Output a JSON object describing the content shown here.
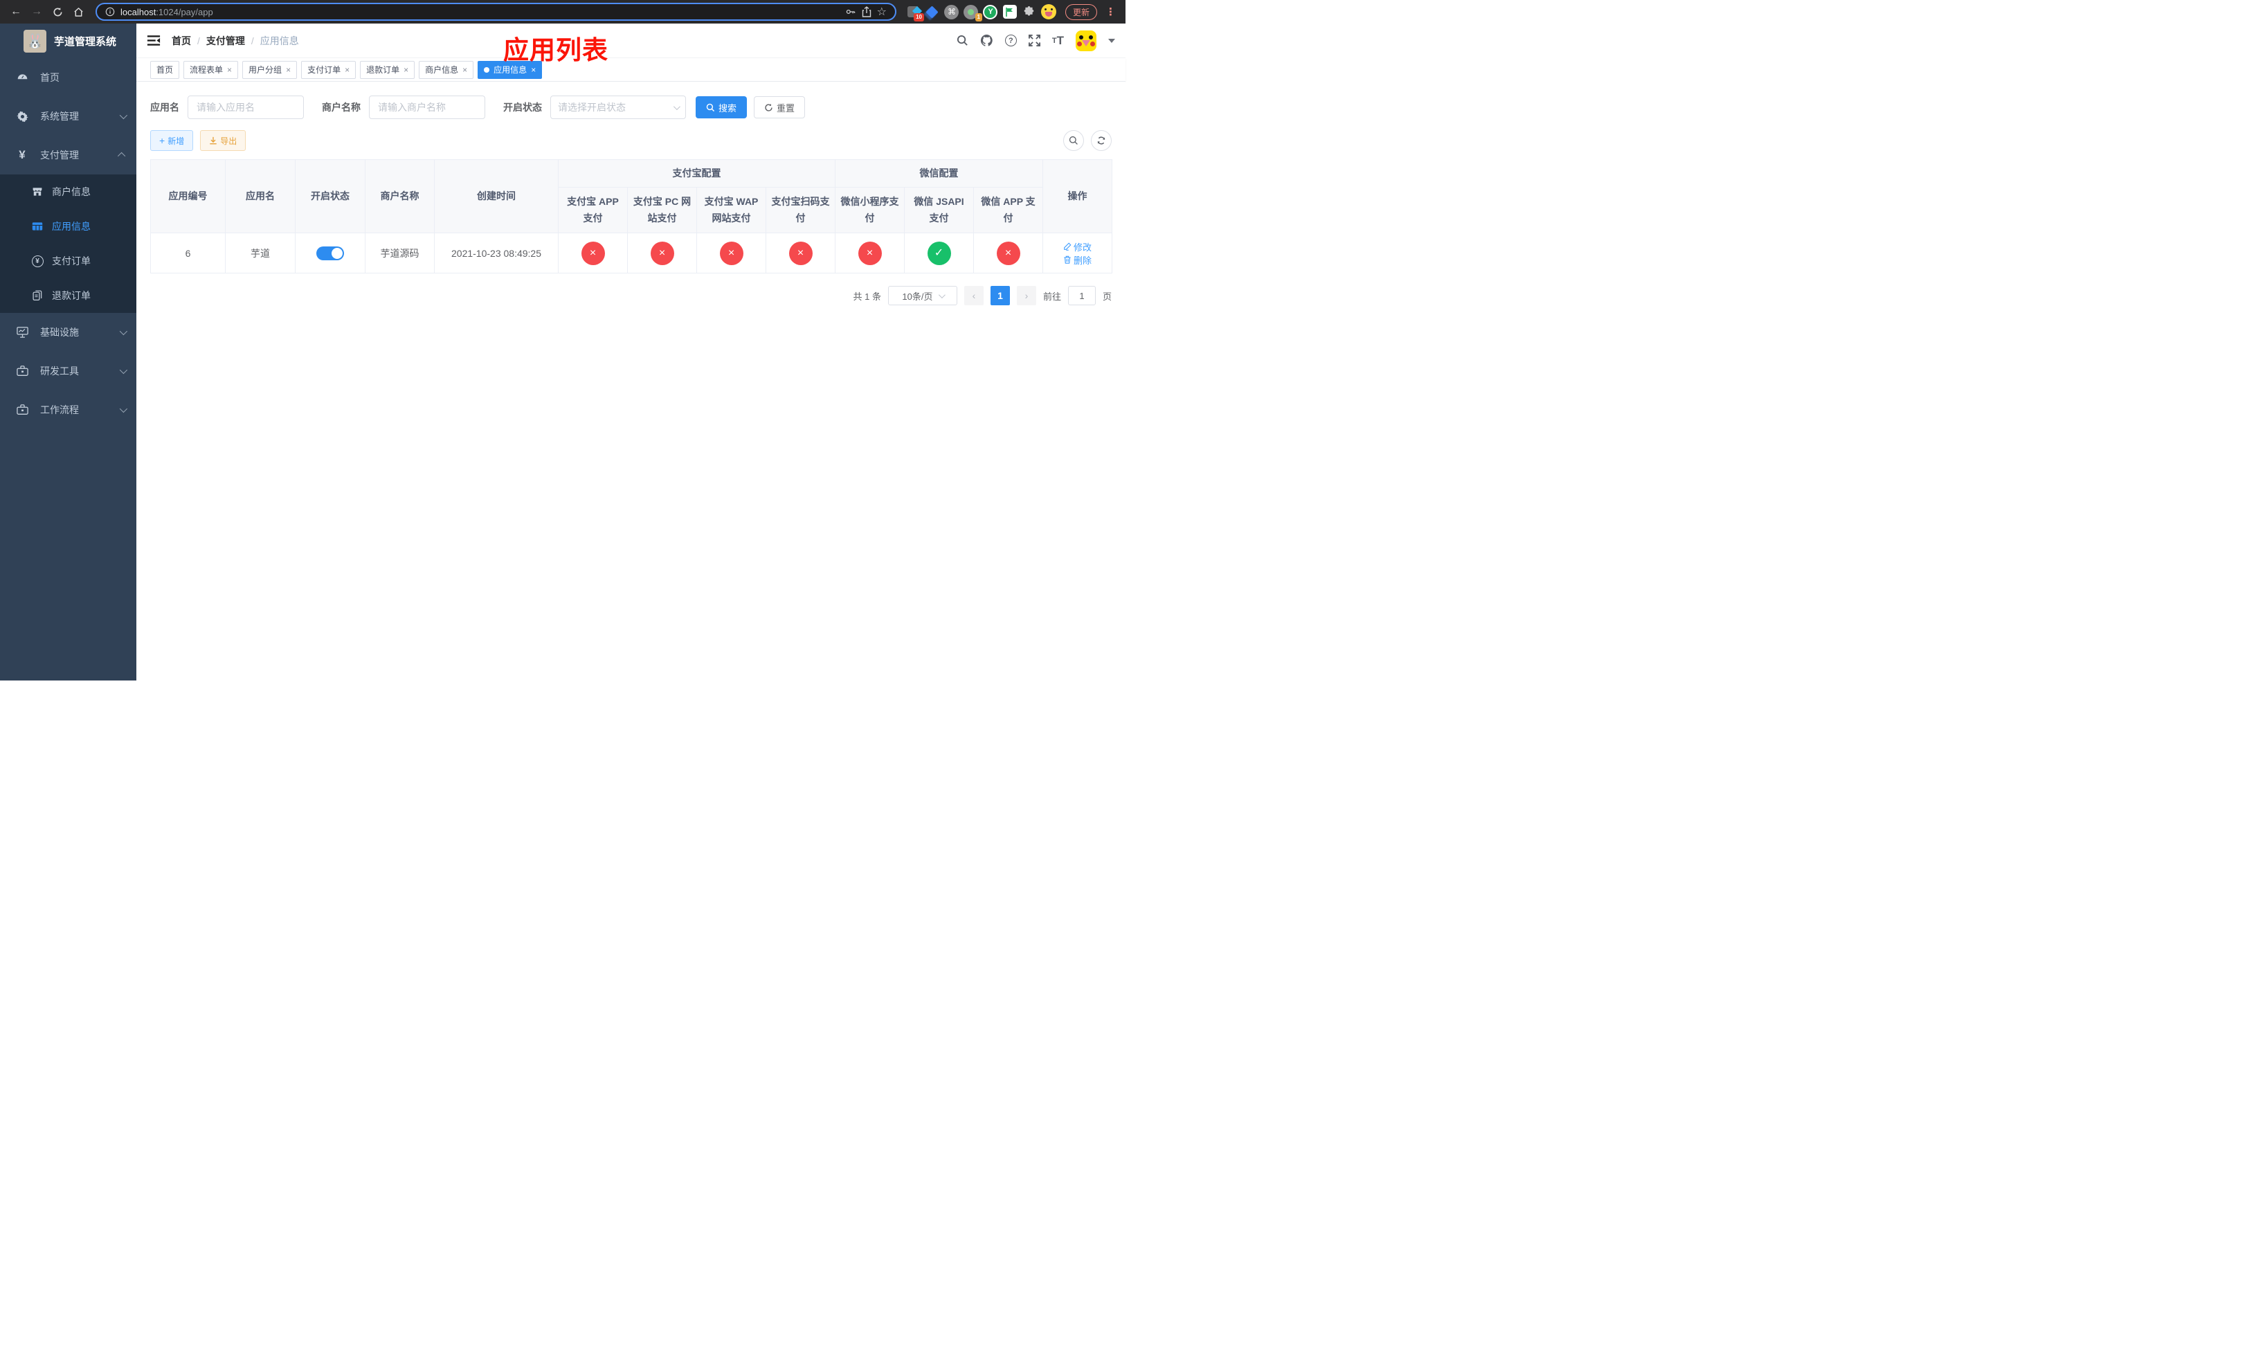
{
  "browser": {
    "url_host": "localhost",
    "url_path": ":1024/pay/app",
    "update_label": "更新",
    "ext_badge_1": "10",
    "ext_badge_2": "1",
    "ext_y_label": "Y",
    "cmd_glyph": "⌘"
  },
  "sidebar": {
    "logo_emoji": "🐰",
    "title": "芋道管理系统",
    "menu": [
      {
        "label": "首页",
        "icon": "dashboard-icon"
      },
      {
        "label": "系统管理",
        "icon": "gear-icon"
      },
      {
        "label": "支付管理",
        "icon": "yuan-icon"
      }
    ],
    "submenu": [
      {
        "label": "商户信息",
        "icon": "shop-icon"
      },
      {
        "label": "应用信息",
        "icon": "grid-icon"
      },
      {
        "label": "支付订单",
        "icon": "yuan-circle-icon"
      },
      {
        "label": "退款订单",
        "icon": "documents-icon"
      }
    ],
    "menu_bottom": [
      {
        "label": "基础设施",
        "icon": "monitor-icon"
      },
      {
        "label": "研发工具",
        "icon": "toolbox-icon"
      },
      {
        "label": "工作流程",
        "icon": "briefcase-icon"
      }
    ]
  },
  "header": {
    "breadcrumb": [
      "首页",
      "支付管理",
      "应用信息"
    ],
    "separator": "/",
    "annotation": "应用列表"
  },
  "tags": [
    {
      "label": "首页"
    },
    {
      "label": "流程表单"
    },
    {
      "label": "用户分组"
    },
    {
      "label": "支付订单"
    },
    {
      "label": "退款订单"
    },
    {
      "label": "商户信息"
    },
    {
      "label": "应用信息"
    }
  ],
  "filters": {
    "app_name_label": "应用名",
    "app_name_placeholder": "请输入应用名",
    "merchant_label": "商户名称",
    "merchant_placeholder": "请输入商户名称",
    "status_label": "开启状态",
    "status_placeholder": "请选择开启状态",
    "search_label": "搜索",
    "reset_label": "重置"
  },
  "toolbar": {
    "add_label": "新增",
    "export_label": "导出"
  },
  "table": {
    "headers": {
      "app_id": "应用编号",
      "app_name": "应用名",
      "status": "开启状态",
      "merchant": "商户名称",
      "created": "创建时间",
      "alipay_group": "支付宝配置",
      "wechat_group": "微信配置",
      "channels": [
        "支付宝 APP 支付",
        "支付宝 PC 网站支付",
        "支付宝 WAP 网站支付",
        "支付宝扫码支付",
        "微信小程序支付",
        "微信 JSAPI 支付",
        "微信 APP 支付"
      ],
      "actions": "操作"
    },
    "row": {
      "app_id": "6",
      "app_name": "芋道",
      "enabled": true,
      "merchant": "芋道源码",
      "created": "2021-10-23 08:49:25",
      "channel_status": [
        "fail",
        "fail",
        "fail",
        "fail",
        "fail",
        "success",
        "fail"
      ],
      "edit_label": "修改",
      "delete_label": "删除"
    },
    "status_glyphs": {
      "fail": "×",
      "success": "✓"
    }
  },
  "pagination": {
    "total": "共 1 条",
    "page_size": "10条/页",
    "page": "1",
    "goto_prefix": "前往",
    "goto_value": "1",
    "goto_suffix": "页"
  }
}
